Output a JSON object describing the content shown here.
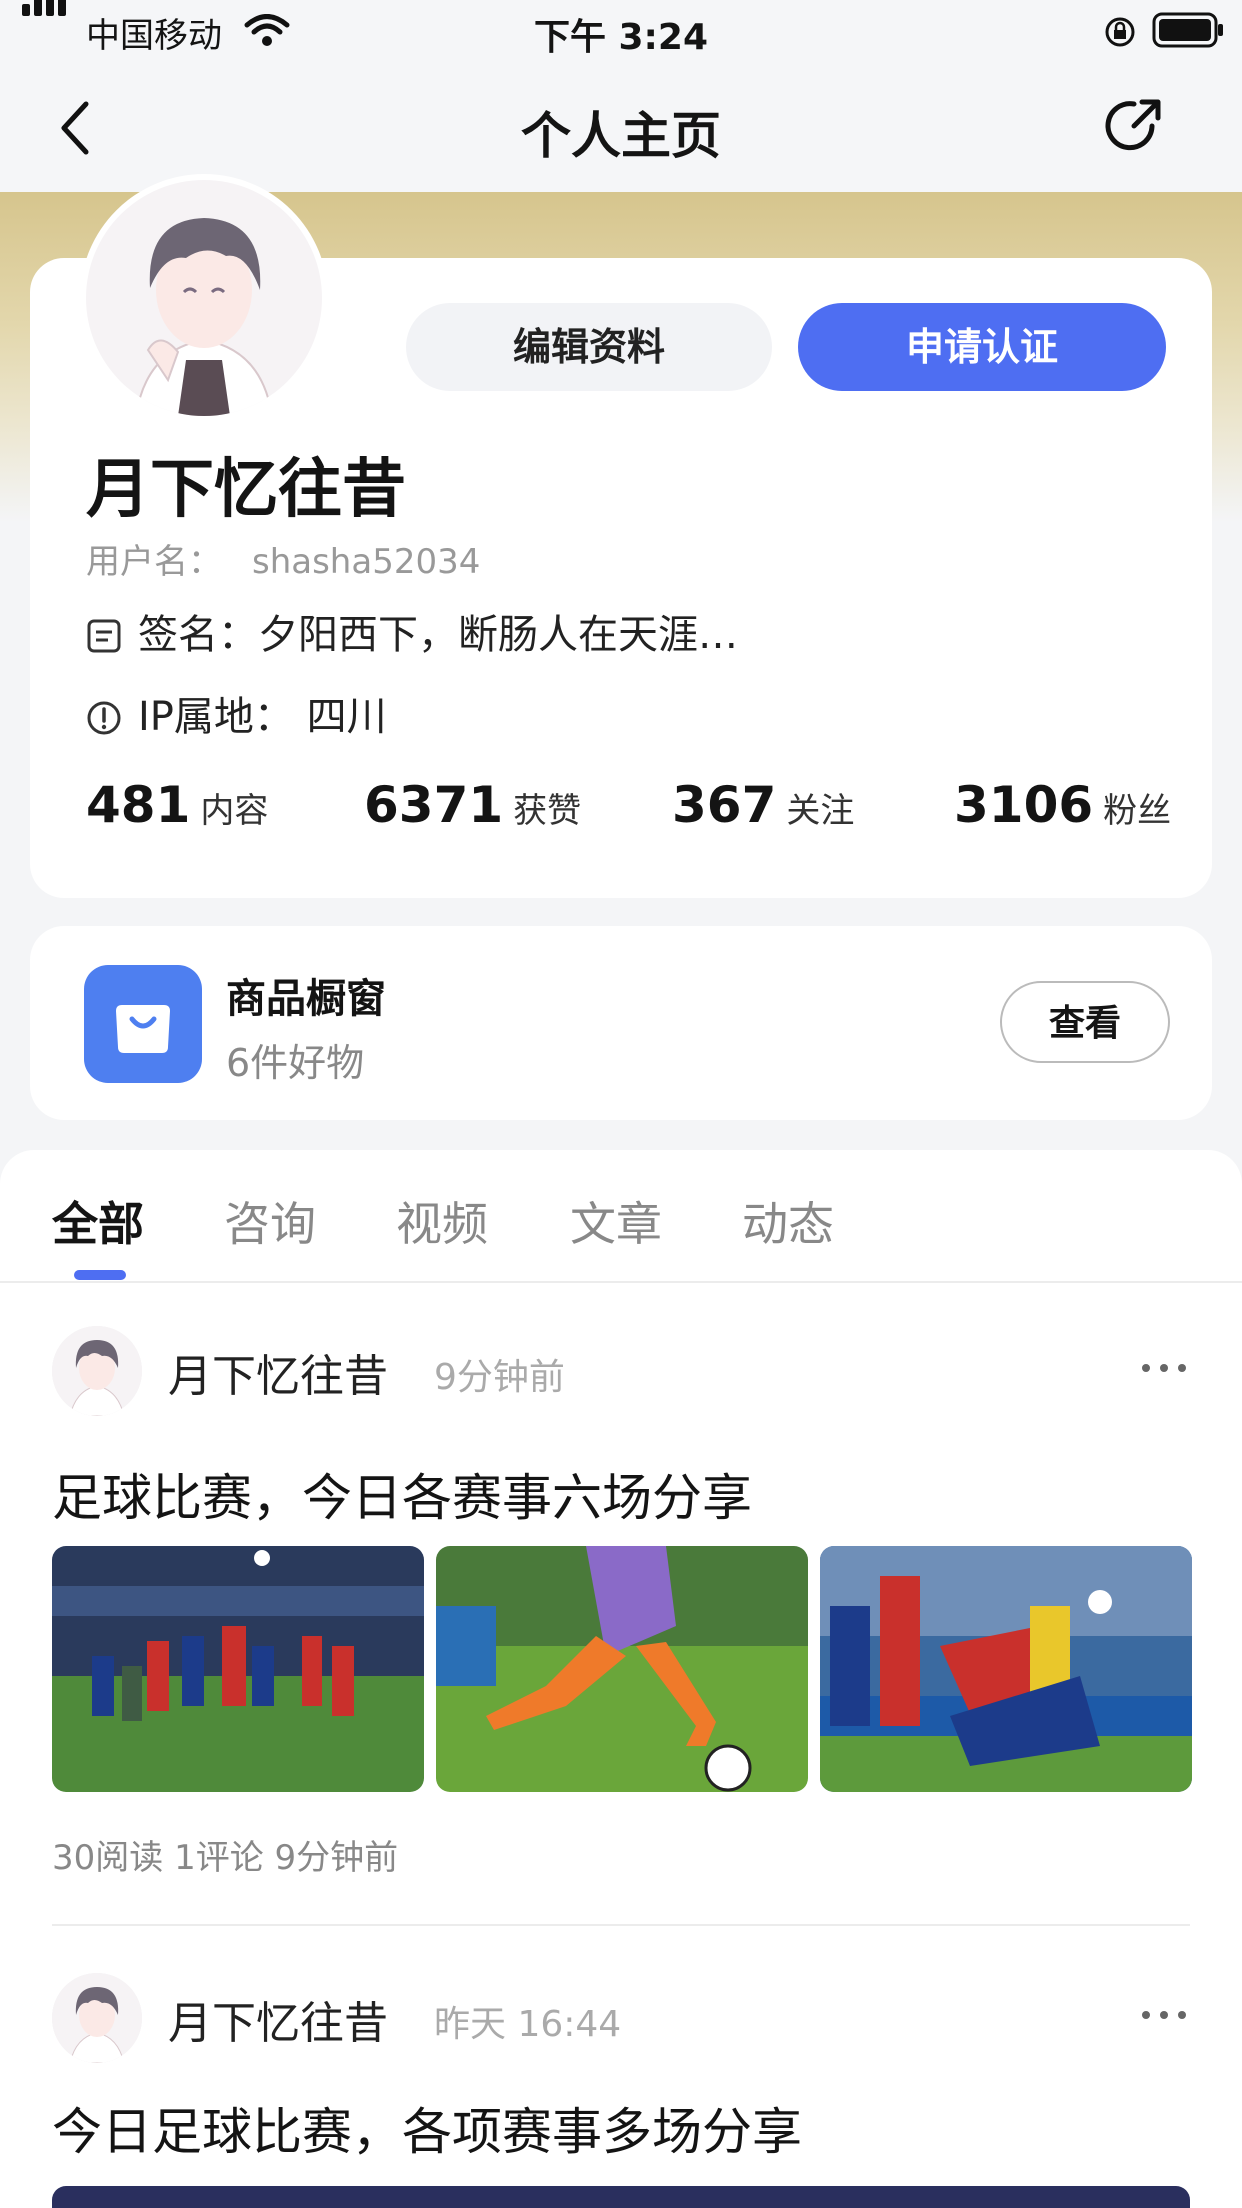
{
  "status_bar": {
    "carrier": "中国移动",
    "time": "下午 3:24"
  },
  "nav": {
    "title": "个人主页"
  },
  "profile": {
    "edit_button": "编辑资料",
    "certify_button": "申请认证",
    "name": "月下忆往昔",
    "username_label": "用户名：",
    "username": "shasha52034",
    "signature": "签名：夕阳西下，断肠人在天涯…",
    "ip": "IP属地： 四川",
    "stats": [
      {
        "value": "481",
        "label": "内容"
      },
      {
        "value": "6371",
        "label": "获赞"
      },
      {
        "value": "367",
        "label": "关注"
      },
      {
        "value": "3106",
        "label": "粉丝"
      }
    ]
  },
  "shop": {
    "title": "商品橱窗",
    "subtitle": "6件好物",
    "button": "查看"
  },
  "tabs": [
    "全部",
    "咨询",
    "视频",
    "文章",
    "动态"
  ],
  "posts": [
    {
      "author": "月下忆往昔",
      "time": "9分钟前",
      "title": "足球比赛，今日各赛事六场分享",
      "meta": "30阅读  1评论  9分钟前"
    },
    {
      "author": "月下忆往昔",
      "time": "昨天 16:44",
      "title": "今日足球比赛，各项赛事多场分享"
    }
  ],
  "colors": {
    "accent": "#4e6ef2",
    "shop_icon": "#4e7ff0"
  }
}
